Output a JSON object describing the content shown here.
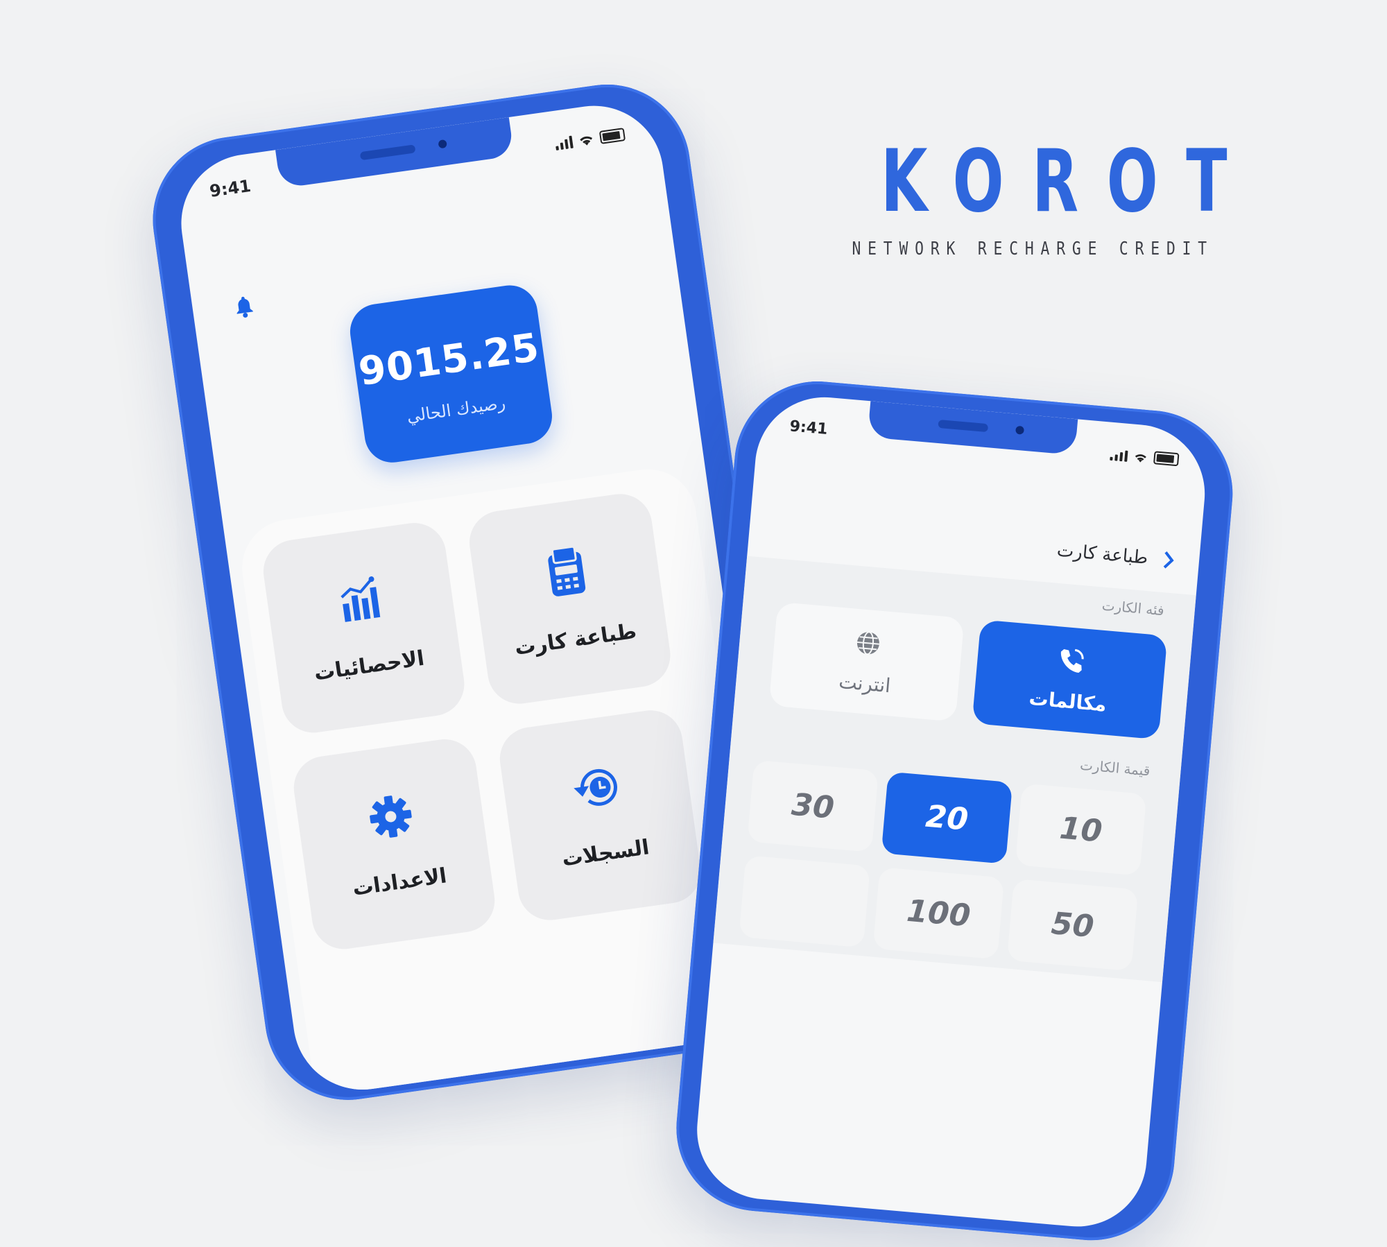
{
  "brand": {
    "title": "KOROT",
    "subtitle": "NETWORK RECHARGE CREDIT",
    "accent_color": "#2f67dd"
  },
  "home_screen": {
    "status": {
      "time": "9:41",
      "icons": [
        "signal-icon",
        "wifi-icon",
        "battery-icon"
      ]
    },
    "notification_icon": "bell-icon",
    "balance": {
      "value": "9015.25",
      "label": "رصيدك الحالي"
    },
    "menu": [
      {
        "id": "stats",
        "label": "الاحصائيات",
        "icon": "chart-icon"
      },
      {
        "id": "print",
        "label": "طباعة كارت",
        "icon": "card-printer-icon"
      },
      {
        "id": "settings",
        "label": "الاعدادات",
        "icon": "gear-icon"
      },
      {
        "id": "logs",
        "label": "السجلات",
        "icon": "history-icon"
      }
    ]
  },
  "print_screen": {
    "status": {
      "time": "9:41"
    },
    "title": "طباعة كارت",
    "category_label": "فئه الكارت",
    "categories": [
      {
        "label": "مكالمات",
        "icon": "phone-icon",
        "selected": true
      },
      {
        "label": "انترنت",
        "icon": "globe-icon",
        "selected": false
      }
    ],
    "value_label": "قيمة الكارت",
    "values": [
      {
        "label": "10",
        "selected": false
      },
      {
        "label": "20",
        "selected": true
      },
      {
        "label": "30",
        "selected": false
      },
      {
        "label": "50",
        "selected": false
      },
      {
        "label": "100",
        "selected": false
      }
    ]
  }
}
